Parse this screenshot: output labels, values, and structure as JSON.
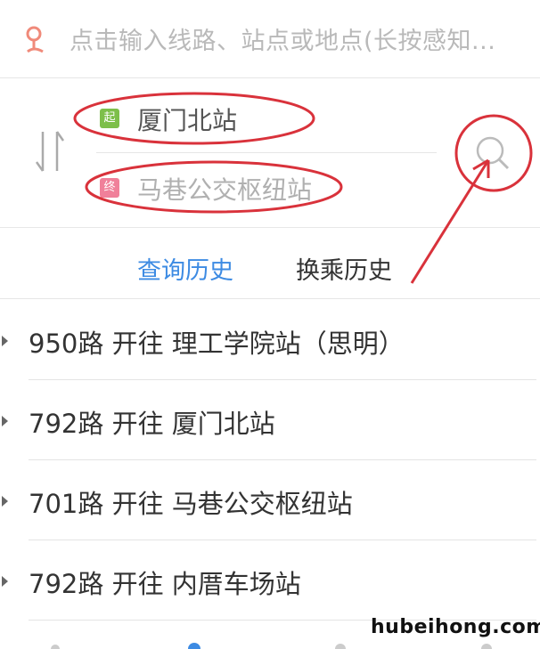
{
  "search": {
    "placeholder": "点击输入线路、站点或地点(长按感知..."
  },
  "route": {
    "start_tag": "起",
    "start_station": "厦门北站",
    "end_tag": "终",
    "end_station": "马巷公交枢纽站"
  },
  "tabs": [
    {
      "label": "查询历史"
    },
    {
      "label": "换乘历史"
    }
  ],
  "history": [
    {
      "text": "950路 开往 理工学院站（思明）"
    },
    {
      "text": "792路 开往 厦门北站"
    },
    {
      "text": "701路 开往 马巷公交枢纽站"
    },
    {
      "text": "792路 开往 内厝车场站"
    }
  ],
  "watermark": "hubeihong.com",
  "colors": {
    "active_tab": "#3d8be3",
    "start_tag": "#7dbf4a",
    "end_tag": "#f0809a",
    "annotation_red": "#d9323b"
  }
}
